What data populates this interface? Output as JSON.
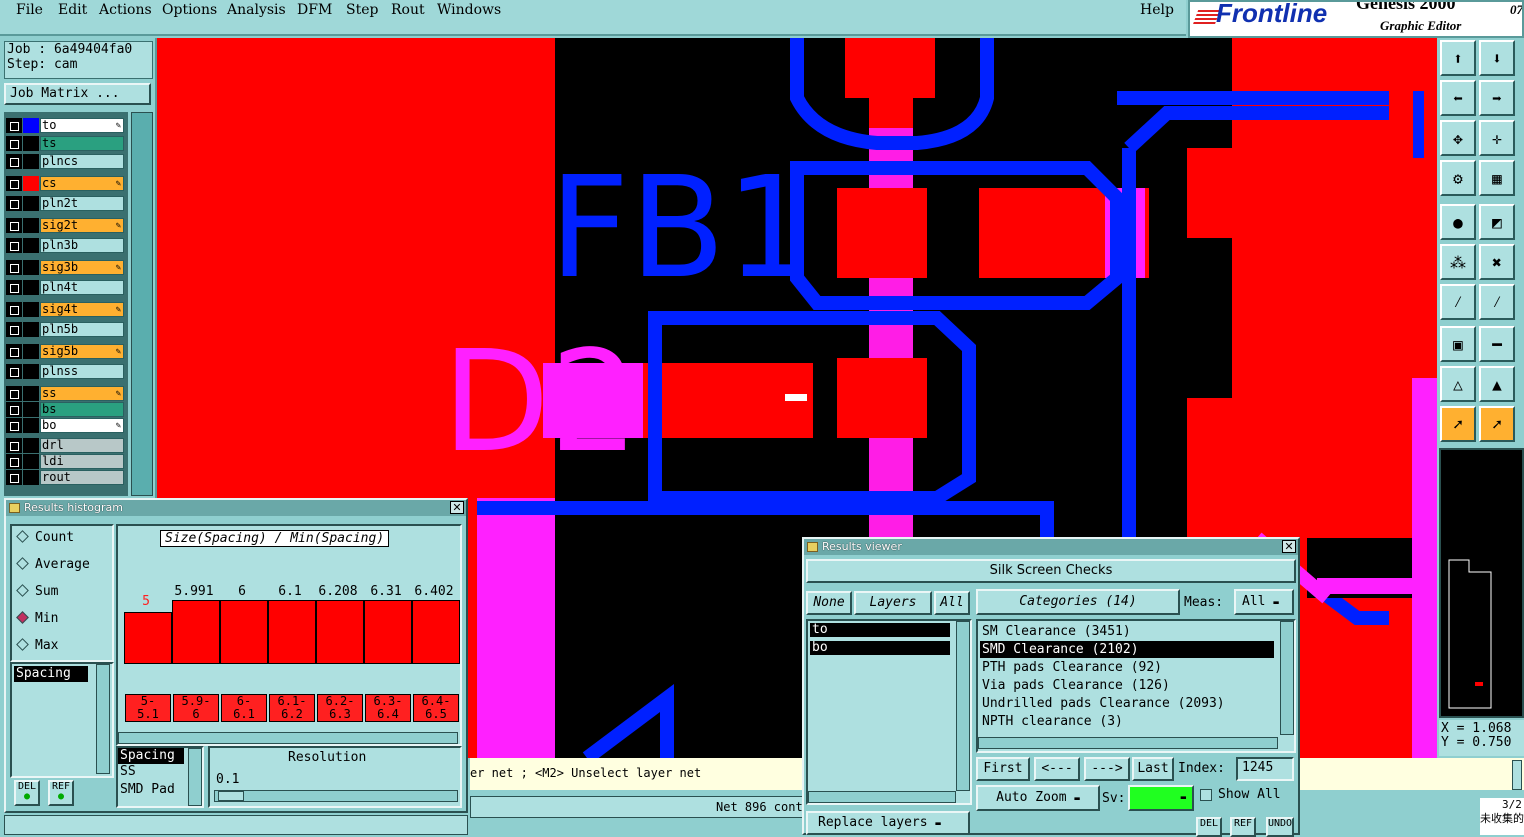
{
  "menu": {
    "items": [
      "File",
      "Edit",
      "Actions",
      "Options",
      "Analysis",
      "DFM",
      "Step",
      "Rout",
      "Windows"
    ],
    "help": "Help"
  },
  "logo": {
    "brand": "Frontline",
    "product": "Genesis 2000",
    "subtitle": "Graphic Editor",
    "corner": "07"
  },
  "job": {
    "job_label": "Job : 6a49404fa0",
    "step_label": "Step: cam",
    "matrix_button": "Job Matrix ..."
  },
  "layers": [
    {
      "name": "to",
      "color": "#ffffff",
      "swatch": "#0000ff",
      "edit": true
    },
    {
      "name": "ts",
      "color": "#2aa080",
      "swatch": "",
      "edit": false
    },
    {
      "name": "plncs",
      "color": "#aee0e0",
      "swatch": "",
      "edit": false
    },
    {
      "name": "cs",
      "color": "#ffb030",
      "swatch": "#ff0000",
      "edit": true
    },
    {
      "name": "pln2t",
      "color": "#aee0e0",
      "swatch": "",
      "edit": false
    },
    {
      "name": "sig2t",
      "color": "#ffb030",
      "swatch": "",
      "edit": true
    },
    {
      "name": "pln3b",
      "color": "#aee0e0",
      "swatch": "",
      "edit": false
    },
    {
      "name": "sig3b",
      "color": "#ffb030",
      "swatch": "",
      "edit": true
    },
    {
      "name": "pln4t",
      "color": "#aee0e0",
      "swatch": "",
      "edit": false
    },
    {
      "name": "sig4t",
      "color": "#ffb030",
      "swatch": "",
      "edit": true
    },
    {
      "name": "pln5b",
      "color": "#aee0e0",
      "swatch": "",
      "edit": false
    },
    {
      "name": "sig5b",
      "color": "#ffb030",
      "swatch": "",
      "edit": true
    },
    {
      "name": "plnss",
      "color": "#aee0e0",
      "swatch": "",
      "edit": false
    },
    {
      "name": "ss",
      "color": "#ffb030",
      "swatch": "",
      "edit": true
    },
    {
      "name": "bs",
      "color": "#2aa080",
      "swatch": "",
      "edit": false
    },
    {
      "name": "bo",
      "color": "#ffffff",
      "swatch": "",
      "edit": true
    },
    {
      "name": "drl",
      "color": "#b8c8c8",
      "swatch": "",
      "edit": false
    },
    {
      "name": "ldi",
      "color": "#b8c8c8",
      "swatch": "",
      "edit": false
    },
    {
      "name": "rout",
      "color": "#b8c8c8",
      "swatch": "",
      "edit": false
    }
  ],
  "canvas": {
    "labels": {
      "fb1": "FB1",
      "d2": "D2"
    },
    "colors": {
      "red": "#ff0000",
      "blue": "#0020ff",
      "magenta": "#ff20ff",
      "black": "#000000"
    }
  },
  "coords": {
    "x": "X = 1.068",
    "y": "Y = 0.750"
  },
  "status": {
    "hint": "er net ; <M2> Unselect layer net",
    "net": "Net 896 cont",
    "corner1": "3/2",
    "corner2": "未收集的"
  },
  "histogram": {
    "title": "Results histogram",
    "modes": [
      {
        "label": "Count",
        "selected": false
      },
      {
        "label": "Average",
        "selected": false
      },
      {
        "label": "Sum",
        "selected": false
      },
      {
        "label": "Min",
        "selected": true
      },
      {
        "label": "Max",
        "selected": false
      }
    ],
    "measure_list": [
      "Spacing"
    ],
    "chart_title": "Size(Spacing) / Min(Spacing)",
    "bar_values": [
      "5",
      "5.991",
      "6",
      "6.1",
      "6.208",
      "6.31",
      "6.402"
    ],
    "bins": [
      "5-\n5.1",
      "5.9-\n6",
      "6-\n6.1",
      "6.1-\n6.2",
      "6.2-\n6.3",
      "6.3-\n6.4",
      "6.4-\n6.5"
    ],
    "attr_list": [
      "Spacing",
      "SS",
      "SMD Pad"
    ],
    "resolution_label": "Resolution",
    "resolution_value": "0.1",
    "del": "DEL",
    "ref": "REF"
  },
  "viewer": {
    "title": "Results viewer",
    "header": "Silk Screen Checks",
    "none_btn": "None",
    "layers_btn": "Layers",
    "all_btn": "All",
    "categories_btn": "Categories (14)",
    "meas_label": "Meas:",
    "meas_value": "All",
    "layers": [
      "to",
      "bo"
    ],
    "categories": [
      {
        "label": "SM Clearance (3451)",
        "selected": false
      },
      {
        "label": "SMD Clearance (2102)",
        "selected": true
      },
      {
        "label": "PTH pads Clearance (92)",
        "selected": false
      },
      {
        "label": "Via pads Clearance (126)",
        "selected": false
      },
      {
        "label": "Undrilled pads Clearance (2093)",
        "selected": false
      },
      {
        "label": "NPTH clearance (3)",
        "selected": false
      }
    ],
    "first": "First",
    "prev": "<---",
    "next": "--->",
    "last": "Last",
    "index_label": "Index:",
    "index_value": "1245",
    "auto_zoom": "Auto Zoom",
    "sv_label": "Sv:",
    "show_all": "Show All",
    "replace_layers": "Replace layers",
    "del": "DEL",
    "ref": "REF",
    "undo": "UNDO"
  }
}
